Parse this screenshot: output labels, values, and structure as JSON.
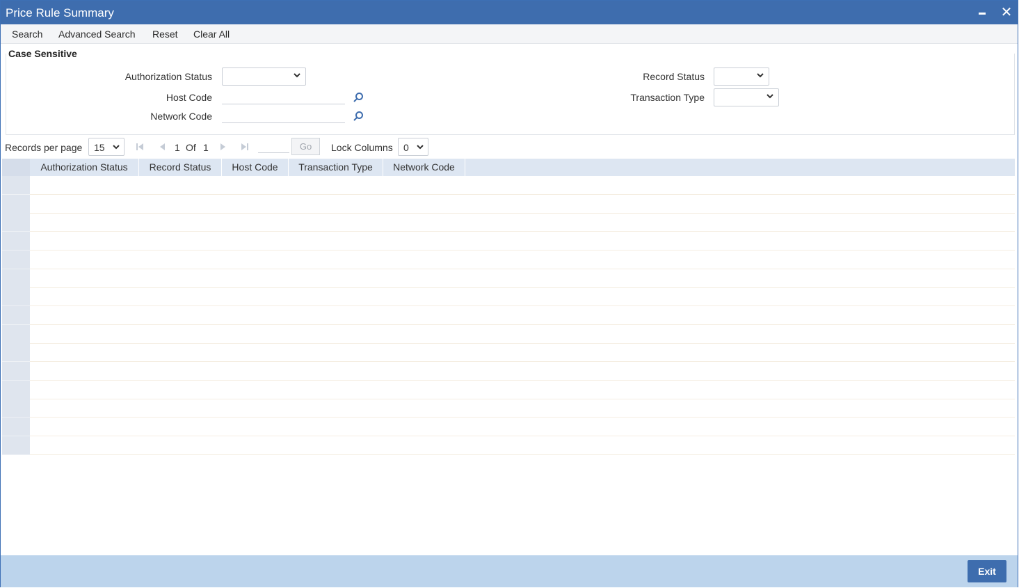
{
  "window": {
    "title": "Price Rule Summary"
  },
  "toolbar": {
    "search": "Search",
    "advanced_search": "Advanced Search",
    "reset": "Reset",
    "clear_all": "Clear All"
  },
  "criteria": {
    "legend": "Case Sensitive",
    "authorization_status_label": "Authorization Status",
    "host_code_label": "Host Code",
    "network_code_label": "Network Code",
    "record_status_label": "Record Status",
    "transaction_type_label": "Transaction Type",
    "authorization_status_value": "",
    "record_status_value": "",
    "transaction_type_value": "",
    "host_code_value": "",
    "network_code_value": ""
  },
  "pager": {
    "records_per_page_label": "Records per page",
    "records_per_page_value": "15",
    "current_page": "1",
    "of_label": "Of",
    "total_pages": "1",
    "go_label": "Go",
    "lock_columns_label": "Lock Columns",
    "lock_columns_value": "0"
  },
  "grid": {
    "columns": [
      "Authorization Status",
      "Record Status",
      "Host Code",
      "Transaction Type",
      "Network Code"
    ],
    "empty_rows": 15
  },
  "footer": {
    "exit_label": "Exit"
  },
  "colors": {
    "accent": "#3e6dae",
    "footer": "#bcd4ec",
    "header": "#dde6f2"
  }
}
